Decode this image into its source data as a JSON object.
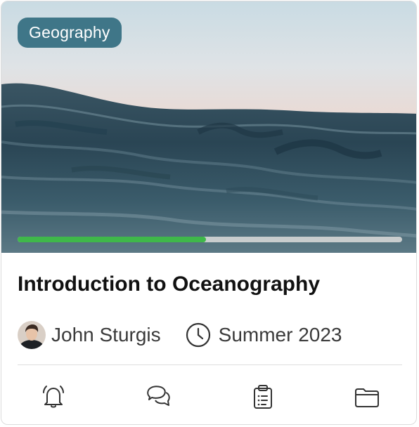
{
  "card": {
    "category": "Geography",
    "title": "Introduction to Oceanography",
    "progress": 0.49,
    "instructor": "John Sturgis",
    "term": "Summer 2023"
  },
  "icons": {
    "term": "clock-icon",
    "actions": [
      "bell-icon",
      "chat-bubbles-icon",
      "clipboard-list-icon",
      "folder-icon"
    ]
  },
  "colors": {
    "tag_bg": "#3f7688",
    "progress_fill": "#3fb84a",
    "progress_track": "#c9cdce",
    "title_text": "#111111",
    "meta_text": "#3a3a3a",
    "icon_stroke": "#333333"
  }
}
